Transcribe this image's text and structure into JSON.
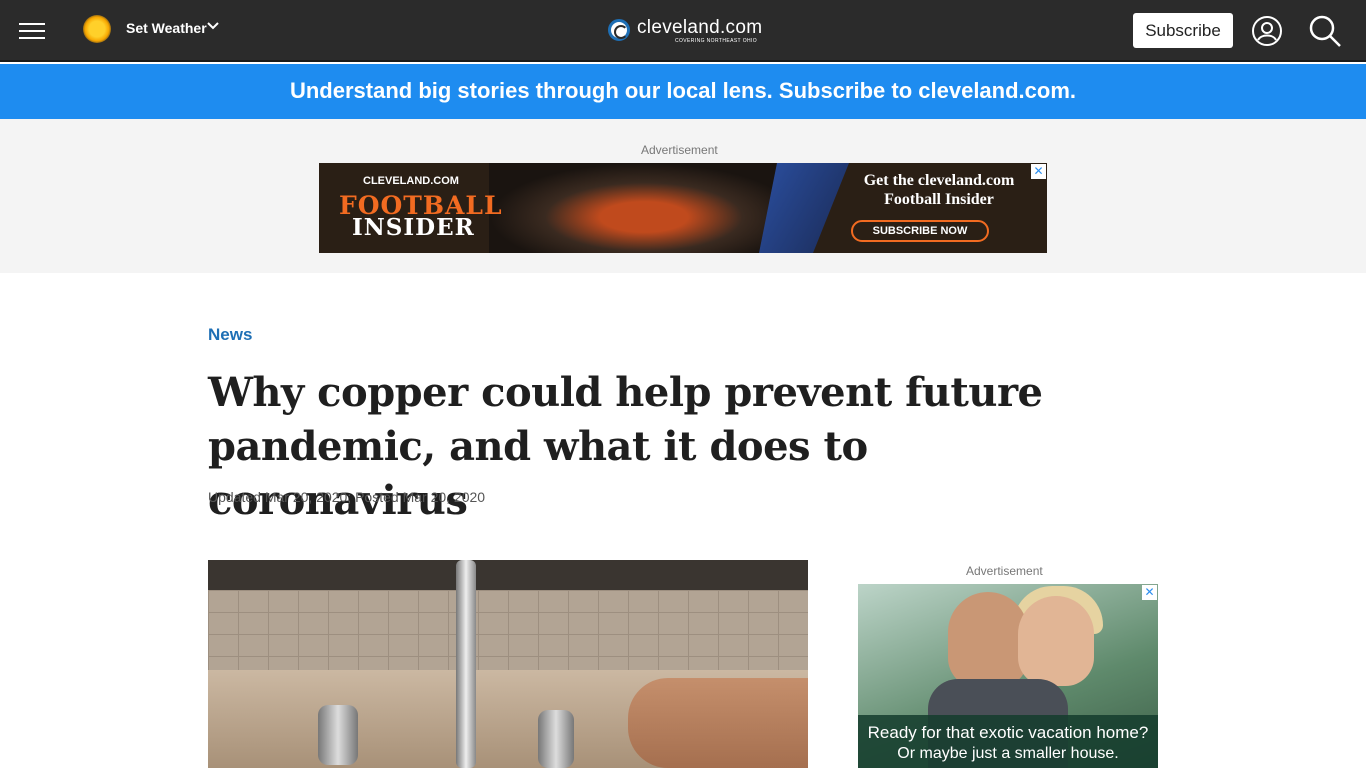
{
  "nav": {
    "weather_label": "Set Weather",
    "weather_chevron": "⌄",
    "logo_name": "cleveland.com",
    "logo_tagline": "COVERING NORTHEAST OHIO",
    "subscribe_label": "Subscribe",
    "icons": [
      "hamburger-menu-icon",
      "sun-weather-icon",
      "chevron-down-icon",
      "account-icon",
      "search-icon"
    ]
  },
  "promo_banner": {
    "text": "Understand big stories through our local lens. Subscribe to cleveland.com."
  },
  "top_ad": {
    "label": "Advertisement",
    "brand_small": "CLEVELAND.COM",
    "brand_line1": "FOOTBALL",
    "brand_line2": "INSIDER",
    "cta_line1": "Get the cleveland.com",
    "cta_line2": "Football Insider",
    "button": "SUBSCRIBE NOW",
    "close": "✕"
  },
  "article": {
    "kicker": "News",
    "headline": "Why copper could help prevent future pandemic, and what it does to coronavirus",
    "dateline": "Updated Mar 20, 2020; Posted Mar 20, 2020"
  },
  "side_ad": {
    "label": "Advertisement",
    "caption_line1": "Ready for that exotic vacation home?",
    "caption_line2": "Or maybe just a smaller house.",
    "close": "✕"
  },
  "colors": {
    "nav_bg": "#2b2b2b",
    "promo_bg": "#1e8cf0",
    "kicker": "#1e6fb5",
    "ad_strip_bg": "#f4f4f4"
  }
}
